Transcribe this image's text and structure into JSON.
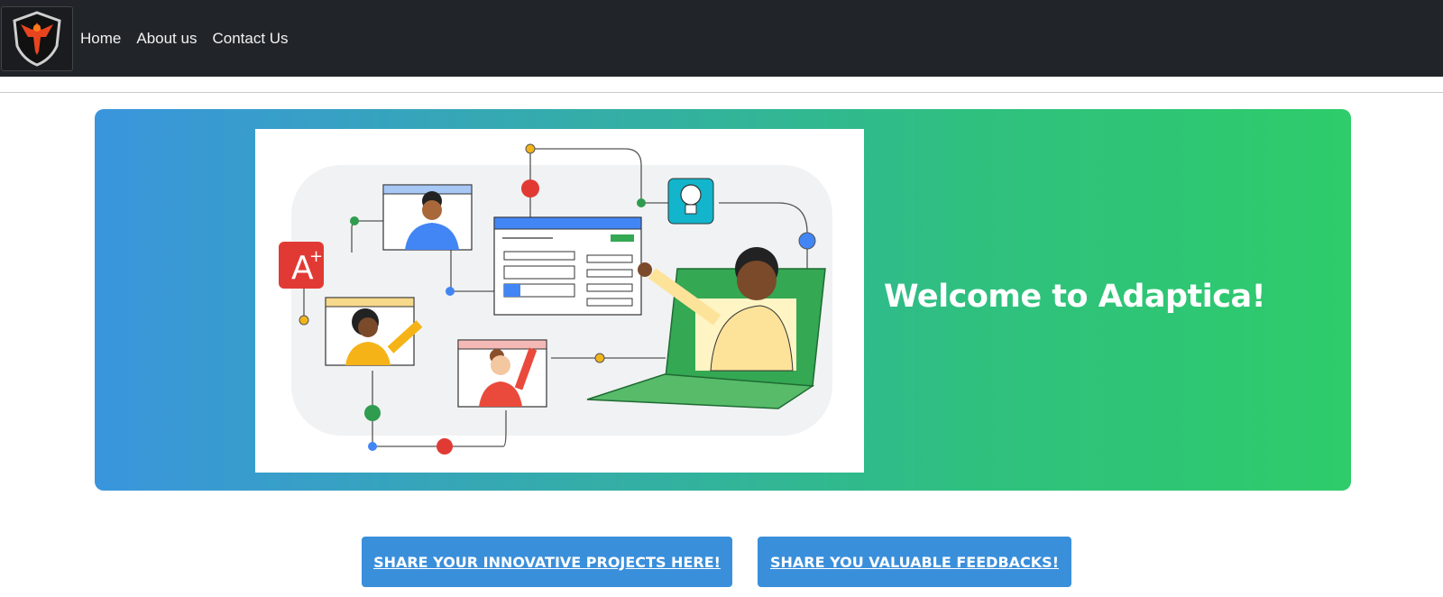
{
  "navbar": {
    "logo_icon": "phoenix-shield-logo",
    "links": [
      "Home",
      "About us",
      "Contact Us"
    ]
  },
  "hero": {
    "title": "Welcome to Adaptica!",
    "illustration": "online-learning-illustration",
    "gradient_start": "#3a95dd",
    "gradient_end": "#2ecc6a",
    "badge_text": "A"
  },
  "buttons": {
    "projects": "SHARE YOUR INNOVATIVE PROJECTS HERE!",
    "feedback": "SHARE YOU VALUABLE FEEDBACKS!"
  }
}
